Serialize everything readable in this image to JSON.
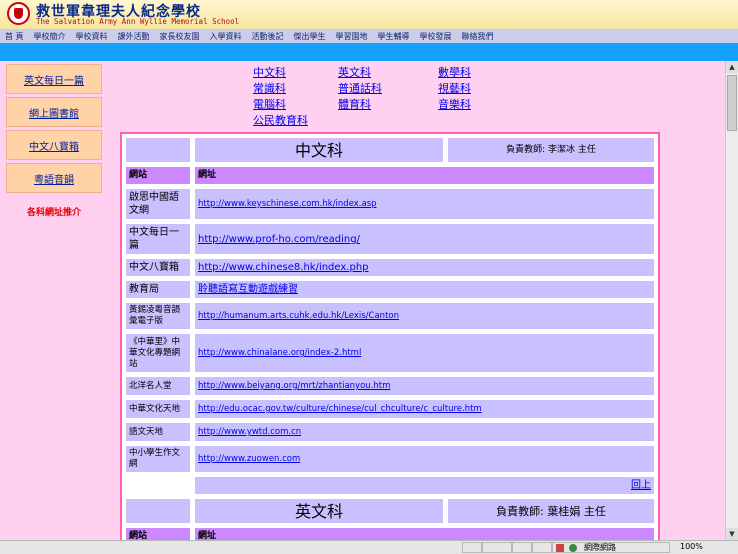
{
  "header": {
    "school_name_zh": "救世軍韋理夫人紀念學校",
    "school_name_en": "The Salvation Army Ann Wyllie Memorial School"
  },
  "nav": [
    "首 頁",
    "學校簡介",
    "學校資料",
    "課外活動",
    "家長校友園",
    "入學資料",
    "活動後記",
    "傑出學生",
    "學習園地",
    "學生輔導",
    "學校發展",
    "聯絡我們"
  ],
  "sidebar": {
    "items": [
      "英文每日一篇",
      "網上圖書館",
      "中文八寶箱",
      "粵語音韻"
    ],
    "current": "各科網址推介"
  },
  "subjects": [
    "中文科",
    "英文科",
    "數學科",
    "常識科",
    "普通話科",
    "視藝科",
    "電腦科",
    "體育科",
    "音樂科",
    "公民教育科"
  ],
  "chinese": {
    "title": "中文科",
    "teacher": "負責教師: 李潔冰 主任",
    "col_site": "網站",
    "col_url": "網址",
    "rows": [
      {
        "site": "啟思中國語文網",
        "url": "http://www.keyschinese.com.hk/index.asp"
      },
      {
        "site": "中文每日一篇",
        "url": "http://www.prof-ho.com/reading/"
      },
      {
        "site": "中文八寶箱",
        "url": "http://www.chinese8.hk/index.php"
      },
      {
        "site": "教育局",
        "url": "聆聽語寫互動遊戲練習"
      },
      {
        "site": "黃錫凌粵音韻彙電子版",
        "url": "http://humanum.arts.cuhk.edu.hk/Lexis/Canton"
      },
      {
        "site": "《中華里》中華文化專題網站",
        "url": "http://www.chinalane.org/index-2.html"
      },
      {
        "site": "北洋名人堂",
        "url": "http://www.beiyang.org/mrt/zhantianyou.htm"
      },
      {
        "site": "中華文化天地",
        "url": "http://edu.ocac.gov.tw/culture/chinese/cul_chculture/c_culture.htm"
      },
      {
        "site": "語文天地",
        "url": "http://www.ywtd.com.cn"
      },
      {
        "site": "中小學生作文網",
        "url": "http://www.zuowen.com"
      }
    ],
    "back_to_top": "回上"
  },
  "english": {
    "title": "英文科",
    "teacher": "負責教師: 葉桂娟 主任",
    "col_site": "網站",
    "col_url": "網址"
  },
  "status": {
    "zone": "網際網路",
    "zoom": "100%"
  }
}
